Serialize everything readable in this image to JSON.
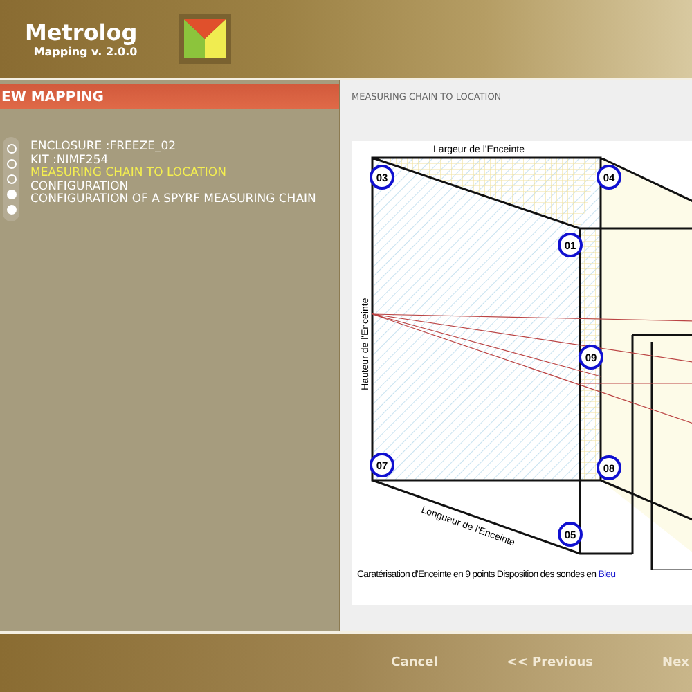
{
  "header": {
    "title": "Metrolog",
    "subtitle": "Mapping v. 2.0.0"
  },
  "sidebar": {
    "title": "EW MAPPING",
    "steps": [
      {
        "label": "ENCLOSURE :FREEZE_02",
        "kind": "open",
        "selected": false
      },
      {
        "label": "KIT :NIMF254",
        "kind": "open",
        "selected": false
      },
      {
        "label": "MEASURING CHAIN TO LOCATION",
        "kind": "open",
        "selected": true
      },
      {
        "label": "CONFIGURATION",
        "kind": "filled",
        "selected": false
      },
      {
        "label": "CONFIGURATION OF A SPYRF MEASURING CHAIN",
        "kind": "filled",
        "selected": false
      }
    ]
  },
  "content": {
    "heading": "MEASURING CHAIN TO LOCATION",
    "figure": {
      "width_label": "Largeur de l'Enceinte",
      "height_label": "Hauteur de l'Enceinte",
      "length_label": "Longueur de l'Enceinte",
      "points": [
        "03",
        "04",
        "01",
        "09",
        "07",
        "08",
        "05"
      ],
      "caption": {
        "text": "Caratérisation d'Enceinte en 9 points Disposition des sondes en",
        "highlight": "Bleu"
      }
    }
  },
  "footer": {
    "buttons": [
      "Cancel",
      "<< Previous",
      "Nex"
    ]
  }
}
